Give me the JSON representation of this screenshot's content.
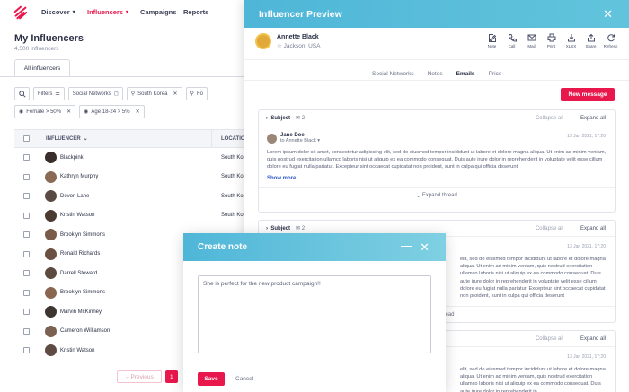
{
  "nav": {
    "items": [
      {
        "label": "Discover",
        "caret": true,
        "active": false
      },
      {
        "label": "Influencers",
        "caret": true,
        "active": true
      },
      {
        "label": "Campaigns",
        "caret": false,
        "active": false
      },
      {
        "label": "Reports",
        "caret": false,
        "active": false
      }
    ]
  },
  "page": {
    "title": "My Influencers",
    "subtitle": "4,500 influencers",
    "tab": "All influencers"
  },
  "filters": {
    "button": "Filters",
    "chips": [
      "Social Networks",
      "South Korea",
      "Fo"
    ],
    "chips2": [
      "Female > 50%",
      "Age 18-24 > 5%"
    ]
  },
  "table": {
    "col_influencer": "INFLUENCER",
    "col_location": "LOCATION",
    "rows": [
      {
        "name": "Blackpink",
        "location": "South Kor"
      },
      {
        "name": "Kathryn Murphy",
        "location": "South Kor"
      },
      {
        "name": "Devon Lane",
        "location": "South Kor"
      },
      {
        "name": "Kristin Watson",
        "location": "South Kor"
      },
      {
        "name": "Brooklyn Simmons",
        "location": ""
      },
      {
        "name": "Ronald Richards",
        "location": ""
      },
      {
        "name": "Darrell Steward",
        "location": ""
      },
      {
        "name": "Brooklyn Simmons",
        "location": ""
      },
      {
        "name": "Marvin McKinney",
        "location": ""
      },
      {
        "name": "Cameron Williamson",
        "location": ""
      },
      {
        "name": "Kristin Watson",
        "location": ""
      }
    ]
  },
  "pager": {
    "previous": "Previous",
    "current": "1"
  },
  "preview": {
    "title": "Influencer Preview",
    "name": "Annette Black",
    "location": "Jackson, USA",
    "actions": [
      "Note",
      "Call",
      "Mail",
      "Print",
      "XLSX",
      "Share",
      "Refresh"
    ],
    "tabs": [
      "Social Networks",
      "Notes",
      "Emails",
      "Price"
    ],
    "active_tab": "Emails",
    "new_message": "New message",
    "threads": [
      {
        "subject": "Subject",
        "count": "2",
        "collapse": "Collapse all",
        "expand": "Expand all",
        "from": "Jane Doe",
        "to": "to Annette Black",
        "date": "13 Jan 2021, 17:20",
        "body1": "Lorem ipsum dolor sit amet, consectetur adipiscing elit, sed do eiusmod tempor incididunt ut labore et dolore magna aliqua. Ut enim ad minim veniam, quis nostrud exercitation ullamco laboris nisi ut aliquip ex ea commodo consequat. Duis aute irure dolor in reprehenderit in voluptate velit esse cillum dolore eu fugiat nulla pariatur. Excepteur sint occaecat cupidatat non proident, sunt in culpa qui officia deserunt",
        "show_more": "Show more",
        "expand_thread": "Expand thread"
      },
      {
        "subject": "Subject",
        "count": "2",
        "collapse": "Collapse all",
        "expand": "Expand all",
        "date": "13 Jan 2021, 17:20",
        "body1": "elit, sed do eiusmod tempor incididunt ut labore et dolore magna aliqua. Ut enim ad minim veniam, quis nostrud exercitation ullamco laboris nisi ut aliquip ex ea commodo consequat. Duis aute irure dolor in reprehenderit in voluptate velit esse cillum dolore eu fugiat nulla pariatur. Excepteur sint occaecat cupidatat non proident, sunt in culpa qui officia deserunt",
        "expand_thread": "Expand thread"
      },
      {
        "collapse": "Collapse all",
        "expand": "Expand all",
        "date": "13 Jan 2021, 17:20",
        "body1": "elit, sed do eiusmod tempor incididunt ut labore et dolore magna aliqua. Ut enim ad minim veniam, quis nostrud exercitation ullamco laboris nisi ut aliquip ex ea commodo consequat. Duis aute irure dolor in reprehenderit in"
      }
    ]
  },
  "modal": {
    "title": "Create note",
    "text": "She is perfect for the new product campaign!!",
    "save": "Save",
    "cancel": "Cancel"
  },
  "colors": {
    "accent": "#e8174c",
    "header": "#4fb6d8",
    "link": "#2d5ac9"
  }
}
